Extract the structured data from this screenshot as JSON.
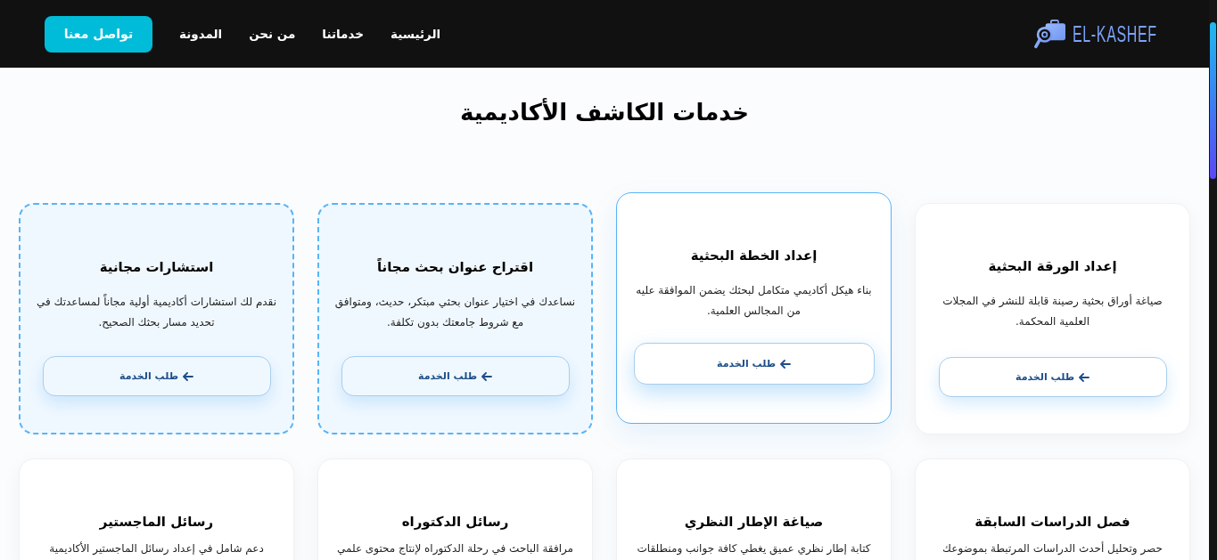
{
  "header": {
    "logo": {
      "text": "EL-KASHEF"
    },
    "links": [
      {
        "label": "الرئيسية"
      },
      {
        "label": "خدماتنا"
      },
      {
        "label": "من نحن"
      },
      {
        "label": "المدونة"
      }
    ],
    "cta": {
      "label": "تواصل معنا"
    }
  },
  "page_title": "خدمات الكاشف الأكاديمية",
  "services": [
    {
      "kind": "standard",
      "title": "إعداد الورقة البحثية",
      "description": "صياغة أوراق بحثية رصينة قابلة للنشر في المجلات العلمية المحكمة.",
      "button": "طلب الخدمة"
    },
    {
      "kind": "highlighted",
      "title": "إعداد الخطة البحثية",
      "description": "بناء هيكل أكاديمي متكامل لبحثك يضمن الموافقة عليه من المجالس العلمية.",
      "button": "طلب الخدمة"
    },
    {
      "kind": "free",
      "title": "اقتراح عنوان بحث مجاناً",
      "description": "نساعدك في اختيار عنوان بحثي مبتكر، حديث، ومتوافق مع شروط جامعتك بدون تكلفة.",
      "button": "طلب الخدمة"
    },
    {
      "kind": "free",
      "title": "استشارات مجانية",
      "description": "نقدم لك استشارات أكاديمية أولية مجاناً لمساعدتك في تحديد مسار بحثك الصحيح.",
      "button": "طلب الخدمة"
    },
    {
      "kind": "standard",
      "title": "فصل الدراسات السابقة",
      "description": "حصر وتحليل أحدث الدراسات المرتبطة بموضوعك"
    },
    {
      "kind": "standard",
      "title": "صياغة الإطار النظري",
      "description": "كتابة إطار نظري عميق يغطي كافة جوانب ومنطلقات"
    },
    {
      "kind": "standard",
      "title": "رسائل الدكتوراه",
      "description": "مرافقة الباحث في رحلة الدكتوراه لإنتاج محتوى علمي"
    },
    {
      "kind": "standard",
      "title": "رسائل الماجستير",
      "description": "دعم شامل في إعداد رسائل الماجستير الأكاديمية"
    }
  ]
}
